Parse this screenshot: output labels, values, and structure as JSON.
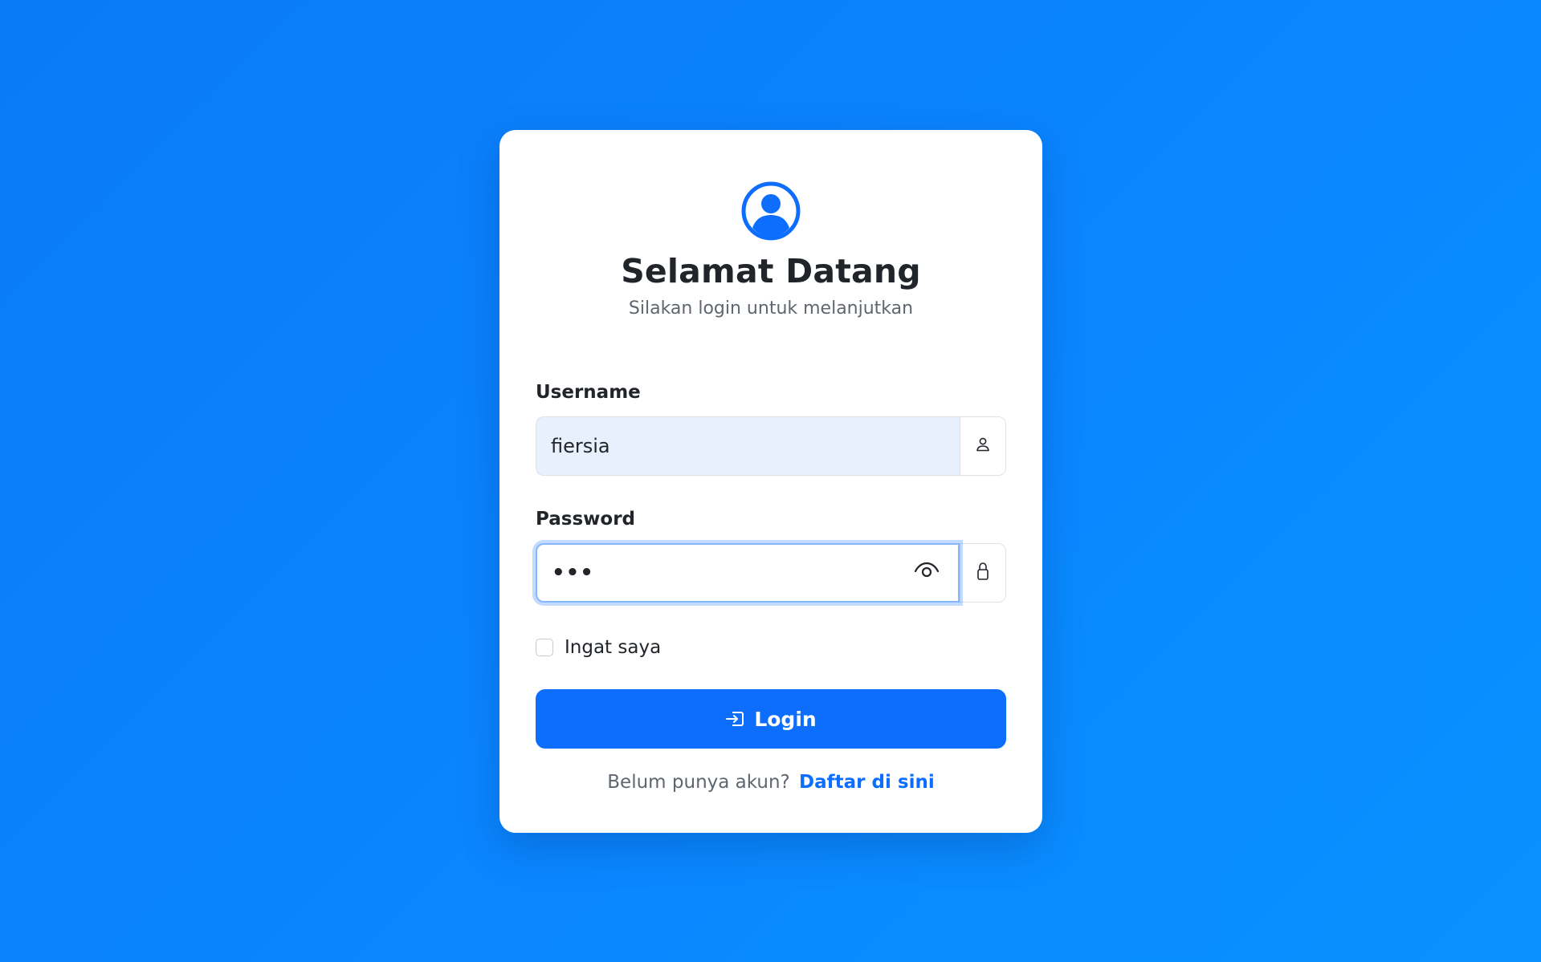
{
  "header": {
    "title": "Selamat Datang",
    "subtitle": "Silakan login untuk melanjutkan"
  },
  "form": {
    "username": {
      "label": "Username",
      "value": "fiersia",
      "icon": "person-icon"
    },
    "password": {
      "label": "Password",
      "masked_value": "•••",
      "toggle_icon": "eye-icon",
      "icon": "lock-icon"
    },
    "remember": {
      "label": "Ingat saya",
      "checked": false
    },
    "submit": {
      "label": "Login",
      "icon": "box-arrow-in-right-icon"
    }
  },
  "footer": {
    "prompt": "Belum punya akun?",
    "link_label": "Daftar di sini"
  },
  "colors": {
    "primary": "#0d6efd",
    "background_start": "#0a7af8",
    "background_end": "#0992ff"
  }
}
